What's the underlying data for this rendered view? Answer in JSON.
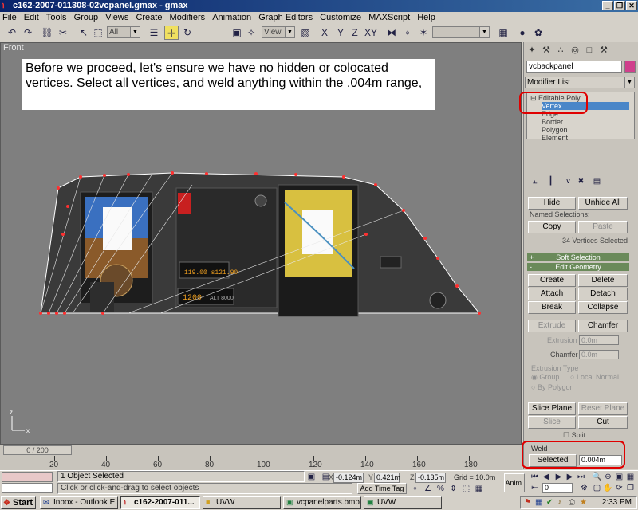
{
  "window": {
    "title": "c162-2007-011308-02vcpanel.gmax - gmax"
  },
  "menu": [
    "File",
    "Edit",
    "Tools",
    "Group",
    "Views",
    "Create",
    "Modifiers",
    "Animation",
    "Graph Editors",
    "Customize",
    "MAXScript",
    "Help"
  ],
  "toolbar": {
    "selection_filter": "All",
    "reference_coord": "View",
    "named_selection": ""
  },
  "viewport": {
    "label": "Front",
    "instruction": "Before we proceed, let's ensure we have no hidden or colocated vertices.  Select all vertices, and weld anything within the .004m range,",
    "instrument": {
      "alt_gauge": "119.00  s121.90",
      "xpdr": "1200",
      "alt_readout": "ALT 8000"
    }
  },
  "panel": {
    "object_name": "vcbackpanel",
    "object_color": "#d0408c",
    "modifier_list": "Modifier List",
    "stack": [
      "Editable Poly",
      "Vertex",
      "Edge",
      "Border",
      "Polygon",
      "Element"
    ],
    "selection": {
      "hide": "Hide",
      "unhide_all": "Unhide All",
      "named_selections": "Named Selections:",
      "copy": "Copy",
      "paste": "Paste",
      "status": "34 Vertices Selected"
    },
    "rollouts": {
      "soft_selection": "Soft Selection",
      "edit_geometry": "Edit Geometry",
      "soft_sign": "+",
      "edit_sign": "-"
    },
    "edit_geometry": {
      "create": "Create",
      "delete": "Delete",
      "attach": "Attach",
      "detach": "Detach",
      "break": "Break",
      "collapse": "Collapse",
      "extrude": "Extrude",
      "chamfer": "Chamfer",
      "extrusion_label": "Extrusion",
      "extrusion_value": "0.0m",
      "chamfer_label": "Chamfer",
      "chamfer_value": "0.0m",
      "extrusion_type": "Extrusion Type",
      "group": "Group",
      "local_normal": "Local Normal",
      "by_polygon": "By Polygon",
      "slice_plane": "Slice Plane",
      "reset_plane": "Reset Plane",
      "slice": "Slice",
      "cut": "Cut",
      "split": "Split"
    },
    "weld": {
      "label": "Weld",
      "selected": "Selected",
      "threshold": "0.004m"
    }
  },
  "timeline": {
    "slider": "0 / 200",
    "ticks": [
      "20",
      "40",
      "60",
      "80",
      "100",
      "120",
      "140",
      "160",
      "180"
    ]
  },
  "status": {
    "objects_selected": "1 Object Selected",
    "prompt": "Click or click-and-drag to select objects",
    "x": "-0.124m",
    "y": "0.421m",
    "z": "-0.135m",
    "grid": "Grid = 10.0m",
    "add_time_tag": "Add Time Tag",
    "anim": "Anim.",
    "frame": "0"
  },
  "taskbar": {
    "start": "Start",
    "tasks": [
      "Inbox - Outlook E...",
      "c162-2007-011...",
      "UVW",
      "vcpanelparts.bmp ...",
      "UVW"
    ],
    "clock": "2:33 PM"
  }
}
